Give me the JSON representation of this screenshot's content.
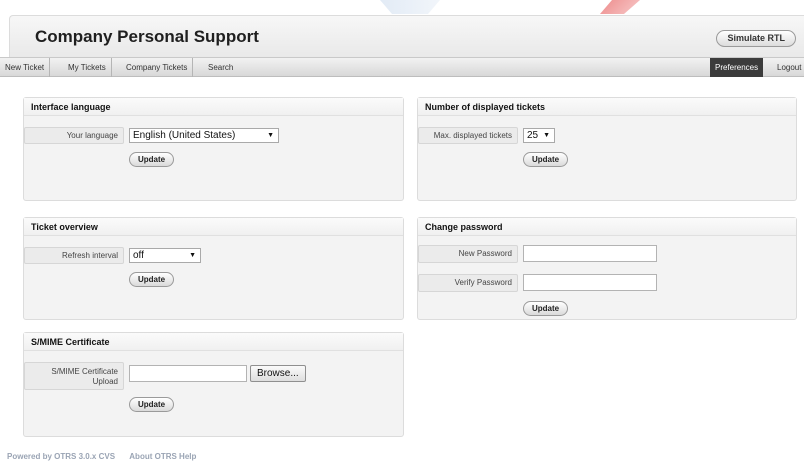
{
  "app": {
    "title": "Company Personal Support",
    "simulate_rtl_label": "Simulate RTL"
  },
  "nav": {
    "items": [
      {
        "label": "New Ticket"
      },
      {
        "label": "My Tickets"
      },
      {
        "label": "Company Tickets"
      },
      {
        "label": "Search"
      }
    ],
    "preferences_label": "Preferences",
    "logout_label": "Logout"
  },
  "panels": {
    "interface_language": {
      "title": "Interface language",
      "label": "Your language",
      "value": "English (United States)",
      "button": "Update"
    },
    "displayed_tickets": {
      "title": "Number of displayed tickets",
      "label": "Max. displayed tickets",
      "value": "25",
      "button": "Update"
    },
    "ticket_overview": {
      "title": "Ticket overview",
      "label": "Refresh interval",
      "value": "off",
      "button": "Update"
    },
    "change_password": {
      "title": "Change password",
      "new_label": "New Password",
      "verify_label": "Verify Password",
      "button": "Update"
    },
    "smime": {
      "title": "S/MIME Certificate",
      "label": "S/MIME Certificate Upload",
      "browse": "Browse...",
      "button": "Update"
    }
  },
  "footer": {
    "powered_by": "Powered by OTRS 3.0.x CVS",
    "about": "About OTRS Help"
  }
}
